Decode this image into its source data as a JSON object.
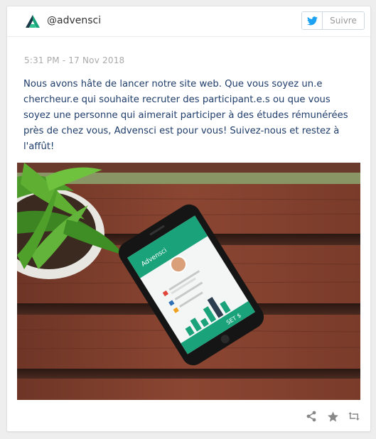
{
  "account": {
    "handle": "@advensci"
  },
  "follow": {
    "label": "Suivre"
  },
  "tweet": {
    "timestamp": "5:31 PM - 17 Nov 2018",
    "text": "Nous avons hâte de lancer notre site web. Que vous soyez un.e chercheur.e qui souhaite recruter des participant.e.s ou que vous soyez une personne qui aimerait participer à des études rémunérées près de chez vous, Advensci est pour vous! Suivez-nous et restez à l'affût!"
  },
  "photo": {
    "phone_brand": "Advensci",
    "phone_button": "SET $"
  },
  "icons": {
    "brand": "advensci-logo-icon",
    "twitter": "twitter-bird-icon",
    "share": "share-icon",
    "favorite": "star-icon",
    "retweet": "retweet-icon"
  },
  "colors": {
    "brand_green": "#1aa37a",
    "twitter_blue": "#1da1f2",
    "text_blue": "#1f3d6b",
    "muted": "#aaaaaa"
  }
}
